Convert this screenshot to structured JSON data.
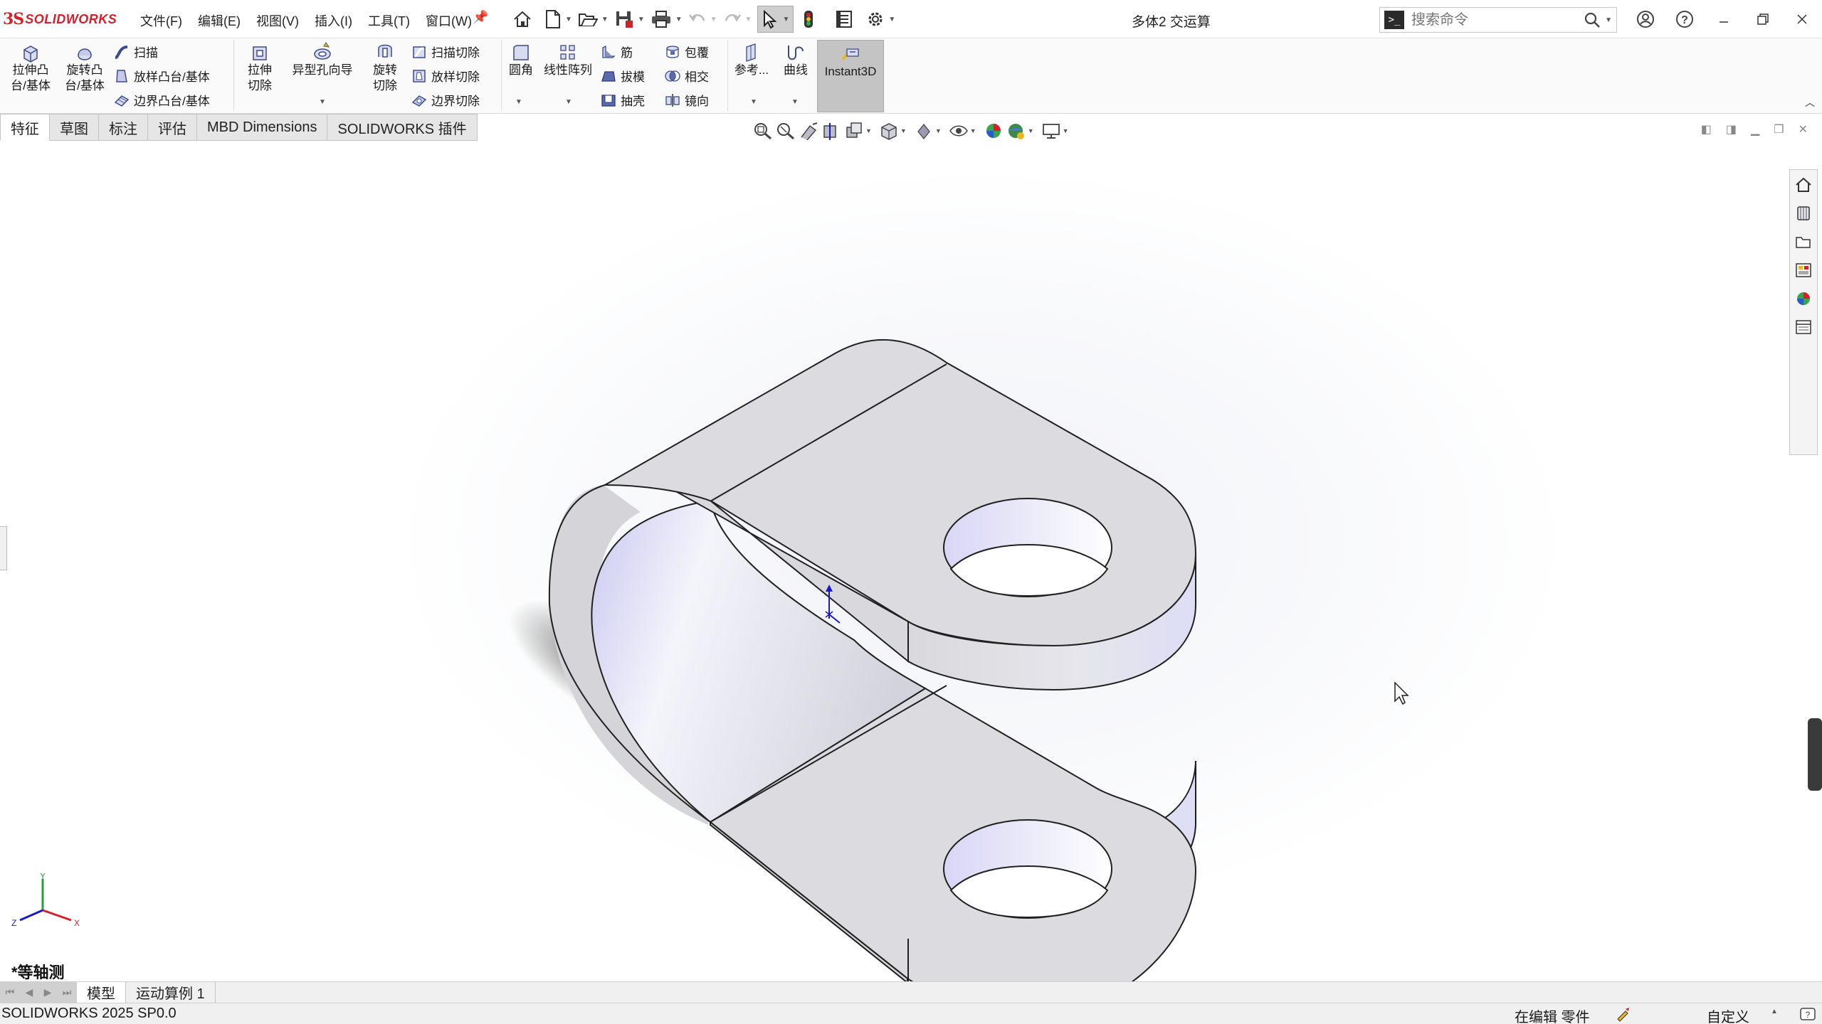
{
  "app": {
    "brand_ds": "3S",
    "brand_name": "SOLIDWORKS",
    "document_title": "多体2 交运算"
  },
  "menu": [
    "文件(F)",
    "编辑(E)",
    "视图(V)",
    "插入(I)",
    "工具(T)",
    "窗口(W)"
  ],
  "search": {
    "placeholder": "搜索命令",
    "icon": "search-icon"
  },
  "command_manager": {
    "extrude_boss": "拉伸凸台/基体",
    "revolve_boss": "旋转凸台/基体",
    "sweep": "扫描",
    "loft_boss": "放样凸台/基体",
    "boundary_boss": "边界凸台/基体",
    "extrude_cut": "拉伸切除",
    "hole_wizard": "异型孔向导",
    "revolve_cut": "旋转切除",
    "swept_cut": "扫描切除",
    "loft_cut": "放样切除",
    "boundary_cut": "边界切除",
    "fillet": "圆角",
    "linear_pattern": "线性阵列",
    "rib": "筋",
    "draft": "拔模",
    "shell": "抽壳",
    "wrap": "包覆",
    "intersect": "相交",
    "mirror": "镜向",
    "reference": "参考...",
    "curves": "曲线",
    "instant3d": "Instant3D"
  },
  "tabs": [
    {
      "label": "特征",
      "active": true
    },
    {
      "label": "草图",
      "active": false
    },
    {
      "label": "标注",
      "active": false
    },
    {
      "label": "评估",
      "active": false
    },
    {
      "label": "MBD Dimensions",
      "active": false
    },
    {
      "label": "SOLIDWORKS 插件",
      "active": false
    }
  ],
  "viewport": {
    "view_name": "*等轴测",
    "triad": {
      "x": "X",
      "y": "Y",
      "z": "Z"
    }
  },
  "bottom_tabs": [
    {
      "label": "模型",
      "active": true
    },
    {
      "label": "运动算例 1",
      "active": false
    }
  ],
  "status": {
    "version": "SOLIDWORKS 2025 SP0.0",
    "mode": "在编辑 零件",
    "units": "自定义"
  },
  "colors": {
    "brand_red": "#d4202a",
    "part_face": "#dcdcdf",
    "part_inner": "#e6e6f5",
    "edge": "#202020",
    "accent_blue": "#1a1acc"
  }
}
